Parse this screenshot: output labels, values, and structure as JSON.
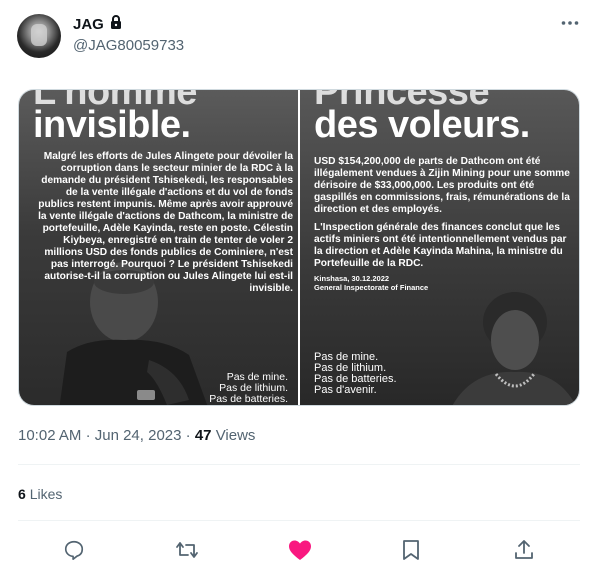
{
  "author": {
    "display_name": "JAG",
    "handle": "@JAG80059733",
    "lock_icon": "lock-icon"
  },
  "poster_left": {
    "headline_partial": "L'homme",
    "headline": "invisible.",
    "body": "Malgré les efforts de Jules Alingete pour dévoiler la corruption dans le secteur minier de la RDC à la demande du président Tshisekedi, les responsables de la vente illégale d'actions et du vol de fonds publics restent impunis. Même après avoir approuvé la vente illégale d'actions de Dathcom, la ministre de portefeuille, Adèle Kayinda, reste en poste. Célestin Kiybeya, enregistré en train de tenter de voler 2 millions USD des fonds publics de Cominiere, n'est pas interrogé. Pourquoi ? Le président Tshisekedi autorise-t-il la corruption ou Jules Alingete lui est-il invisible.",
    "footer": [
      "Pas de mine.",
      "Pas de lithium.",
      "Pas de batteries."
    ]
  },
  "poster_right": {
    "headline_partial": "Princesse",
    "headline": "des voleurs.",
    "paragraph1": "USD $154,200,000 de parts de Dathcom ont été illégalement vendues à Zijin Mining pour une somme dérisoire de $33,000,000. Les produits ont été gaspillés en commissions, frais, rémunérations de la direction et des employés.",
    "paragraph2": "L'Inspection générale des finances conclut que les actifs miniers ont été intentionnellement vendus par la direction et Adèle Kayinda Mahina, la ministre du Portefeuille de la RDC.",
    "source_line1": "Kinshasa, 30.12.2022",
    "source_line2": "General Inspectorate of Finance",
    "footer": [
      "Pas de mine.",
      "Pas de lithium.",
      "Pas de batteries.",
      "Pas d'avenir."
    ]
  },
  "meta": {
    "time": "10:02 AM",
    "separator": "·",
    "date": "Jun 24, 2023",
    "views_count": "47",
    "views_label": "Views"
  },
  "engagement": {
    "likes_count": "6",
    "likes_label": "Likes"
  },
  "colors": {
    "like_active": "#f91880",
    "icon_gray": "#536471",
    "divider": "#eff3f4"
  }
}
